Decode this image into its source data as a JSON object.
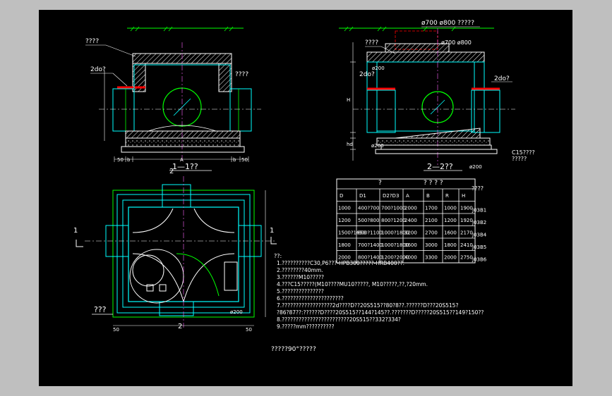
{
  "section_1_title": "1—1??",
  "section_2_title": "2—2??",
  "plan_title": "???",
  "scale_note": "?????90°?????",
  "labels": {
    "cover_left": "????",
    "d2_left": "2do?",
    "fill_left": "????",
    "pipe_top": "ø700 ø800 ?????",
    "pipe_top2": "ø700 ø800",
    "cover_right": "????",
    "d2_right_a": "2do?",
    "d2_right_b": "2do?",
    "dim_200_a": "ø200",
    "dim_200_b": "ø200",
    "dim_200_c": "ø200",
    "dim_200_d": "ø200",
    "c15": "C15????",
    "c15b": "?????",
    "dim_50": "50",
    "dim_b": "b",
    "dim_a": "A",
    "dim_h": "H",
    "dim_hd": "hd",
    "marker_1": "1",
    "marker_2": "2"
  },
  "table": {
    "caption_left": "?",
    "caption_right": "? ? ? ?",
    "side_label": "????",
    "headers": [
      "D",
      "D1",
      "D2?D3",
      "A",
      "B",
      "R",
      "H"
    ],
    "rows": [
      {
        "cells": [
          "1000",
          "400?700",
          "700?1000",
          "2000",
          "1700",
          "1000",
          "1900"
        ],
        "code": "J03B1"
      },
      {
        "cells": [
          "1200",
          "500?800",
          "800?1200",
          "2400",
          "2100",
          "1200",
          "1920"
        ],
        "code": "J03B2"
      },
      {
        "cells": [
          "1500?1650",
          "600?1100",
          "1000?1800",
          "3200",
          "2700",
          "1600",
          "2170"
        ],
        "code": "J03B4"
      },
      {
        "cells": [
          "1800",
          "700?1400",
          "1000?1800",
          "3600",
          "3000",
          "1800",
          "2410"
        ],
        "code": "J03B5"
      },
      {
        "cells": [
          "2000",
          "800?1400",
          "1200?2000",
          "4000",
          "3300",
          "2000",
          "2750"
        ],
        "code": "J03B6"
      }
    ]
  },
  "notes": {
    "heading": "??:",
    "lines": [
      "1.??????????C30,P6???-HPB300?????-HRB400??.",
      "2.????????40mm.",
      "3.??????M10?????",
      "4.???C15?????(M10????MU10?????, M10?????,??,?20mm.",
      "5.???????????????",
      "6.??????????????????????",
      "7.??????????????????2d????D??20S515??80?8??.??????D???20S515?",
      "?86?87??:??????D????20S515??144?145??.???????D?????20S515??149?150??",
      "8.????????????????????????20S515??332?334?",
      "9.?????mm??????????"
    ]
  },
  "colors": {
    "background": "#000000",
    "frame": "#bfbfbf",
    "cyan": "#00ffff",
    "green": "#00ff00",
    "red": "#ff0000",
    "yellow": "#ffff66",
    "white": "#ffffff"
  }
}
